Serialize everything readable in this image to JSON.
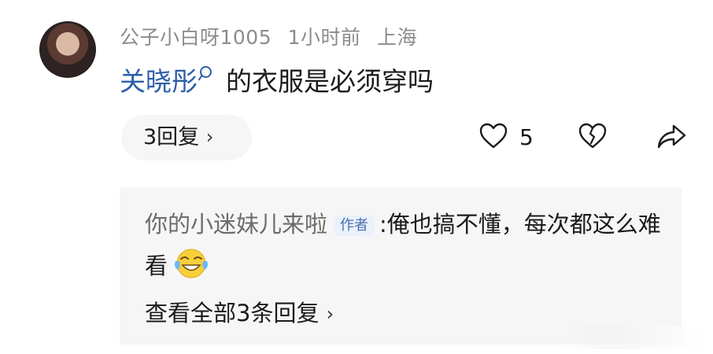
{
  "comment": {
    "username": "公子小白呀1005",
    "time": "1小时前",
    "location": "上海",
    "mention": "关晓彤",
    "text": "的衣服是必须穿吗",
    "replies_button": "3回复",
    "like_count": "5"
  },
  "icons": {
    "like": "heart-outline-icon",
    "dislike": "broken-heart-icon",
    "share": "share-arrow-icon",
    "mention_search": "search-icon",
    "reply_emoji": "crying-laughing-emoji-icon"
  },
  "reply_preview": {
    "username": "你的小迷妹儿来啦",
    "author_badge": "作者",
    "separator": ":",
    "text": "俺也搞不懂，每次都这么难看",
    "view_all": "查看全部3条回复"
  },
  "colors": {
    "mention": "#2c5ea8",
    "meta_text": "#8c8c8c",
    "reply_background": "#f6f6f6",
    "badge_text": "#4a6fb0",
    "badge_background": "#eaf1fb"
  }
}
